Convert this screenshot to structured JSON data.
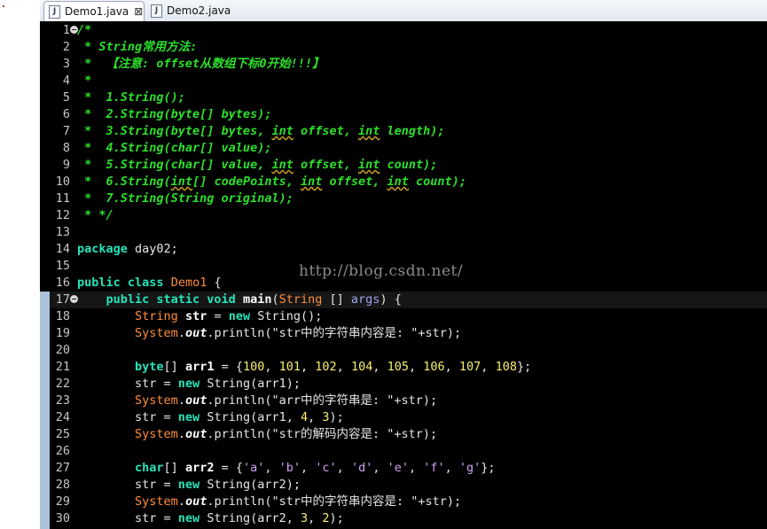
{
  "tabs": [
    {
      "label": "Demo1.java",
      "icon": "java-file-icon",
      "close": "⊠"
    },
    {
      "label": "Demo2.java",
      "icon": "java-file-icon"
    }
  ],
  "watermark": "http://blog.csdn.net/",
  "colors": {
    "background": "#000000",
    "comment": "#2cdf2a",
    "keyword": "#26e3ba",
    "class": "#ff8e38",
    "number": "#f6f06a"
  },
  "lines": [
    {
      "n": "1",
      "fold": true,
      "segs": [
        [
          "cmt",
          "/*"
        ]
      ]
    },
    {
      "n": "2",
      "segs": [
        [
          "cmt",
          " * String常用方法:"
        ]
      ]
    },
    {
      "n": "3",
      "segs": [
        [
          "cmt",
          " *  【注意: offset从数组下标0开始!!!】"
        ]
      ]
    },
    {
      "n": "4",
      "segs": [
        [
          "cmt",
          " *"
        ]
      ]
    },
    {
      "n": "5",
      "segs": [
        [
          "cmt",
          " *  1.String();"
        ]
      ]
    },
    {
      "n": "6",
      "segs": [
        [
          "cmt",
          " *  2.String(byte[] bytes);"
        ]
      ]
    },
    {
      "n": "7",
      "segs": [
        [
          "cmt",
          " *  3.String(byte[] bytes, "
        ],
        [
          "cmt sq",
          "int"
        ],
        [
          "cmt",
          " offset, "
        ],
        [
          "cmt sq",
          "int"
        ],
        [
          "cmt",
          " length);"
        ]
      ]
    },
    {
      "n": "8",
      "segs": [
        [
          "cmt",
          " *  4.String(char[] value);"
        ]
      ]
    },
    {
      "n": "9",
      "segs": [
        [
          "cmt",
          " *  5.String(char[] value, "
        ],
        [
          "cmt sq",
          "int"
        ],
        [
          "cmt",
          " offset, "
        ],
        [
          "cmt sq",
          "int"
        ],
        [
          "cmt",
          " count);"
        ]
      ]
    },
    {
      "n": "10",
      "segs": [
        [
          "cmt",
          " *  6.String("
        ],
        [
          "cmt sq",
          "int"
        ],
        [
          "cmt",
          "[] codePoints, "
        ],
        [
          "cmt sq",
          "int"
        ],
        [
          "cmt",
          " offset, "
        ],
        [
          "cmt sq",
          "int"
        ],
        [
          "cmt",
          " count);"
        ]
      ]
    },
    {
      "n": "11",
      "segs": [
        [
          "cmt",
          " *  7.String(String original);"
        ]
      ]
    },
    {
      "n": "12",
      "segs": [
        [
          "cmt",
          " * */"
        ]
      ]
    },
    {
      "n": "13",
      "segs": []
    },
    {
      "n": "14",
      "segs": [
        [
          "kw",
          "package"
        ],
        [
          "plain",
          " day02;"
        ]
      ]
    },
    {
      "n": "15",
      "segs": []
    },
    {
      "n": "16",
      "segs": [
        [
          "kw",
          "public class"
        ],
        [
          "plain",
          " "
        ],
        [
          "cls",
          "Demo1"
        ],
        [
          "plain",
          " {"
        ]
      ]
    },
    {
      "n": "17",
      "fold": true,
      "current": true,
      "segs": [
        [
          "plain",
          "    "
        ],
        [
          "kw",
          "public static void"
        ],
        [
          "plain",
          " "
        ],
        [
          "mth",
          "main"
        ],
        [
          "plain",
          "("
        ],
        [
          "cls",
          "String"
        ],
        [
          "plain",
          " [] "
        ],
        [
          "param",
          "args"
        ],
        [
          "plain",
          ") {"
        ]
      ]
    },
    {
      "n": "18",
      "segs": [
        [
          "plain",
          "        "
        ],
        [
          "cls",
          "String"
        ],
        [
          "plain",
          " "
        ],
        [
          "var",
          "str"
        ],
        [
          "plain",
          " = "
        ],
        [
          "kw",
          "new"
        ],
        [
          "plain",
          " String();"
        ]
      ]
    },
    {
      "n": "19",
      "segs": [
        [
          "plain",
          "        "
        ],
        [
          "cls",
          "System"
        ],
        [
          "plain",
          "."
        ],
        [
          "fld",
          "out"
        ],
        [
          "plain",
          ".println("
        ],
        [
          "str",
          "\"str中的字符串内容是: \""
        ],
        [
          "plain",
          "+str);"
        ]
      ]
    },
    {
      "n": "20",
      "segs": []
    },
    {
      "n": "21",
      "segs": [
        [
          "plain",
          "        "
        ],
        [
          "kw",
          "byte"
        ],
        [
          "plain",
          "[] "
        ],
        [
          "var",
          "arr1"
        ],
        [
          "plain",
          " = {"
        ],
        [
          "num",
          "100"
        ],
        [
          "plain",
          ", "
        ],
        [
          "num",
          "101"
        ],
        [
          "plain",
          ", "
        ],
        [
          "num",
          "102"
        ],
        [
          "plain",
          ", "
        ],
        [
          "num",
          "104"
        ],
        [
          "plain",
          ", "
        ],
        [
          "num",
          "105"
        ],
        [
          "plain",
          ", "
        ],
        [
          "num",
          "106"
        ],
        [
          "plain",
          ", "
        ],
        [
          "num",
          "107"
        ],
        [
          "plain",
          ", "
        ],
        [
          "num",
          "108"
        ],
        [
          "plain",
          "};"
        ]
      ]
    },
    {
      "n": "22",
      "segs": [
        [
          "plain",
          "        str = "
        ],
        [
          "kw",
          "new"
        ],
        [
          "plain",
          " String(arr1);"
        ]
      ]
    },
    {
      "n": "23",
      "segs": [
        [
          "plain",
          "        "
        ],
        [
          "cls",
          "System"
        ],
        [
          "plain",
          "."
        ],
        [
          "fld",
          "out"
        ],
        [
          "plain",
          ".println("
        ],
        [
          "str",
          "\"arr中的字符串是: \""
        ],
        [
          "plain",
          "+str);"
        ]
      ]
    },
    {
      "n": "24",
      "segs": [
        [
          "plain",
          "        str = "
        ],
        [
          "kw",
          "new"
        ],
        [
          "plain",
          " String(arr1, "
        ],
        [
          "num",
          "4"
        ],
        [
          "plain",
          ", "
        ],
        [
          "num",
          "3"
        ],
        [
          "plain",
          ");"
        ]
      ]
    },
    {
      "n": "25",
      "segs": [
        [
          "plain",
          "        "
        ],
        [
          "cls",
          "System"
        ],
        [
          "plain",
          "."
        ],
        [
          "fld",
          "out"
        ],
        [
          "plain",
          ".println("
        ],
        [
          "str",
          "\"str的解码内容是: \""
        ],
        [
          "plain",
          "+str);"
        ]
      ]
    },
    {
      "n": "26",
      "segs": []
    },
    {
      "n": "27",
      "segs": [
        [
          "plain",
          "        "
        ],
        [
          "kw",
          "char"
        ],
        [
          "plain",
          "[] "
        ],
        [
          "var",
          "arr2"
        ],
        [
          "plain",
          " = {"
        ],
        [
          "chr",
          "'a'"
        ],
        [
          "plain",
          ", "
        ],
        [
          "chr",
          "'b'"
        ],
        [
          "plain",
          ", "
        ],
        [
          "chr",
          "'c'"
        ],
        [
          "plain",
          ", "
        ],
        [
          "chr",
          "'d'"
        ],
        [
          "plain",
          ", "
        ],
        [
          "chr",
          "'e'"
        ],
        [
          "plain",
          ", "
        ],
        [
          "chr",
          "'f'"
        ],
        [
          "plain",
          ", "
        ],
        [
          "chr",
          "'g'"
        ],
        [
          "plain",
          "};"
        ]
      ]
    },
    {
      "n": "28",
      "segs": [
        [
          "plain",
          "        str = "
        ],
        [
          "kw",
          "new"
        ],
        [
          "plain",
          " String(arr2);"
        ]
      ]
    },
    {
      "n": "29",
      "segs": [
        [
          "plain",
          "        "
        ],
        [
          "cls",
          "System"
        ],
        [
          "plain",
          "."
        ],
        [
          "fld",
          "out"
        ],
        [
          "plain",
          ".println("
        ],
        [
          "str",
          "\"str中的字符串内容是: \""
        ],
        [
          "plain",
          "+str);"
        ]
      ]
    },
    {
      "n": "30",
      "segs": [
        [
          "plain",
          "        str = "
        ],
        [
          "kw",
          "new"
        ],
        [
          "plain",
          " String(arr2, "
        ],
        [
          "num",
          "3"
        ],
        [
          "plain",
          ", "
        ],
        [
          "num",
          "2"
        ],
        [
          "plain",
          ");"
        ]
      ]
    }
  ]
}
